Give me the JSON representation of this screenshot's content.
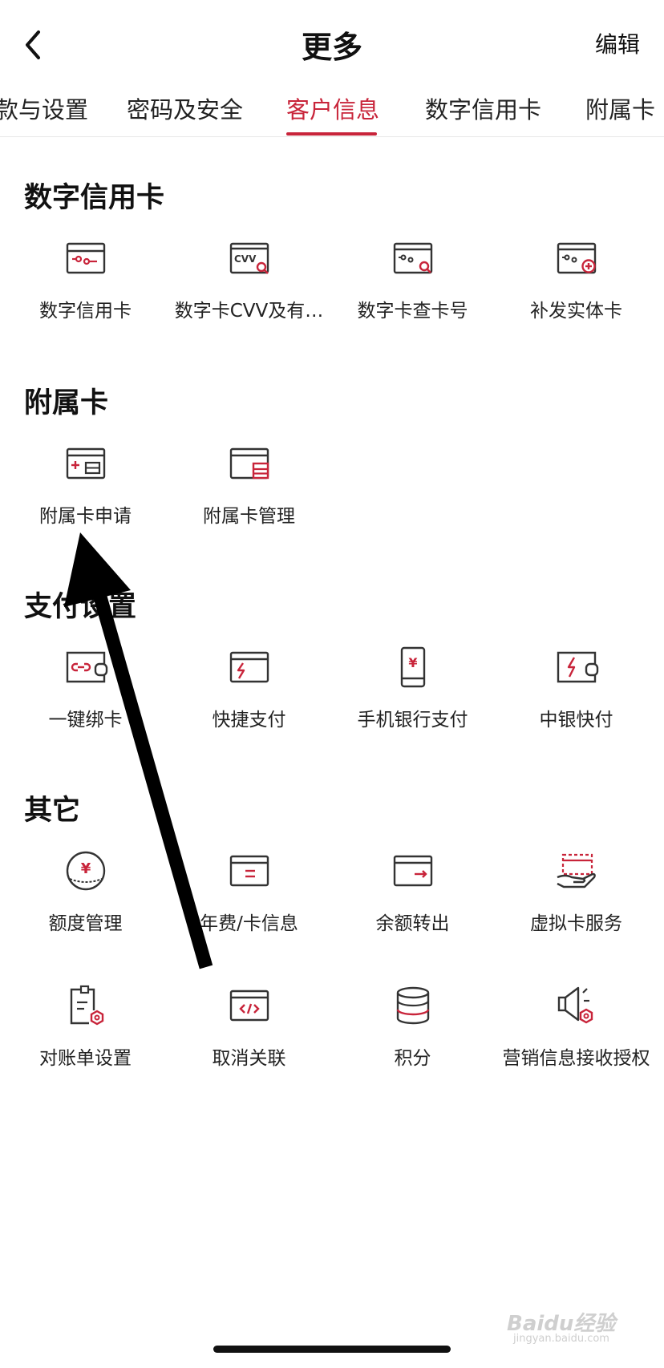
{
  "header": {
    "title": "更多",
    "edit": "编辑"
  },
  "tabs": [
    "款与设置",
    "密码及安全",
    "客户信息",
    "数字信用卡",
    "附属卡"
  ],
  "sections": {
    "digital": {
      "title": "数字信用卡",
      "items": [
        "数字信用卡",
        "数字卡CVV及有…",
        "数字卡查卡号",
        "补发实体卡"
      ]
    },
    "supp": {
      "title": "附属卡",
      "items": [
        "附属卡申请",
        "附属卡管理"
      ]
    },
    "pay": {
      "title": "支付设置",
      "items": [
        "一键绑卡",
        "快捷支付",
        "手机银行支付",
        "中银快付"
      ]
    },
    "other": {
      "title": "其它",
      "items": [
        "额度管理",
        "年费/卡信息",
        "余额转出",
        "虚拟卡服务",
        "对账单设置",
        "取消关联",
        "积分",
        "营销信息接收授权"
      ]
    }
  },
  "icons": {
    "digital": [
      "card-link-icon",
      "card-cvv-icon",
      "card-search-icon",
      "card-reissue-icon"
    ],
    "supp": [
      "card-add-icon",
      "card-manage-icon"
    ],
    "pay": [
      "bind-card-icon",
      "quick-pay-icon",
      "mobile-pay-icon",
      "boc-quickpay-icon"
    ],
    "other": [
      "credit-limit-icon",
      "annual-fee-icon",
      "balance-transfer-icon",
      "virtual-card-icon",
      "statement-settings-icon",
      "unlink-icon",
      "points-icon",
      "marketing-auth-icon"
    ]
  },
  "colors": {
    "accent": "#c8243a",
    "icon_stroke": "#333333"
  },
  "watermark": {
    "brand": "Baidu经验",
    "url": "jingyan.baidu.com"
  }
}
